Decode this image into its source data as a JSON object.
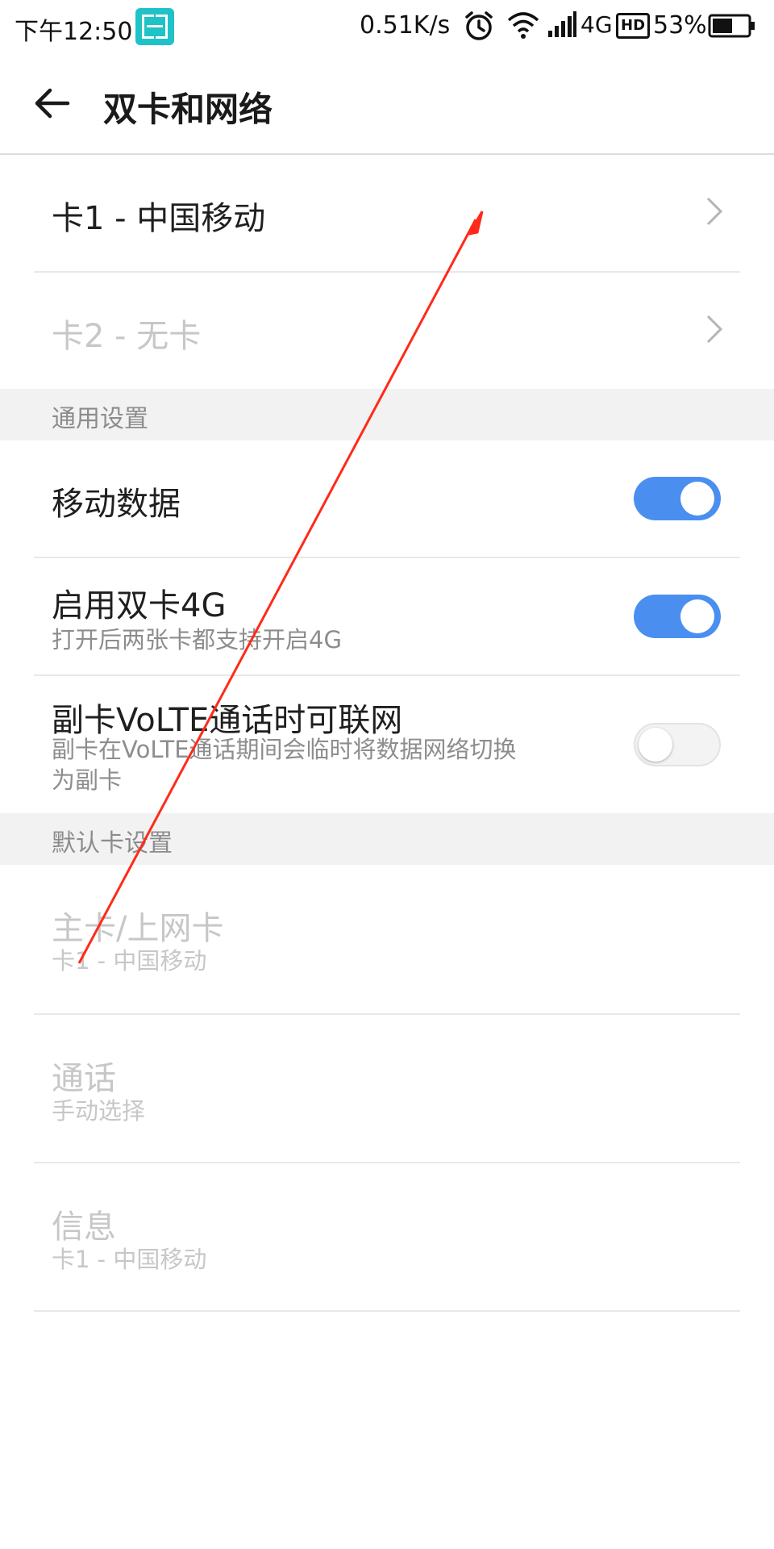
{
  "status_bar": {
    "time": "下午12:50",
    "net_speed": "0.51K/s",
    "network": "4G",
    "hd": "HD",
    "battery": "53%",
    "icons": [
      "screenshot-scan-icon",
      "alarm-icon",
      "wifi-icon",
      "signal-icon",
      "hd-icon",
      "battery-icon"
    ]
  },
  "header": {
    "title": "双卡和网络",
    "back_icon": "back-arrow-icon"
  },
  "sim_cards": [
    {
      "label": "卡1 - 中国移动",
      "enabled": true
    },
    {
      "label": "卡2 - 无卡",
      "enabled": false
    }
  ],
  "general": {
    "section_label": "通用设置",
    "mobile_data": {
      "label": "移动数据",
      "on": true
    },
    "dual_4g": {
      "label": "启用双卡4G",
      "sub": "打开后两张卡都支持开启4G",
      "on": true
    },
    "volte": {
      "label": "副卡VoLTE通话时可联网",
      "sub_line1": "副卡在VoLTE通话期间会临时将数据网络切换",
      "sub_line2": "为副卡",
      "on": false
    }
  },
  "default_card": {
    "section_label": "默认卡设置",
    "items": [
      {
        "label": "主卡/上网卡",
        "sub": "卡1 - 中国移动"
      },
      {
        "label": "通话",
        "sub": "手动选择"
      },
      {
        "label": "信息",
        "sub": "卡1 - 中国移动"
      }
    ]
  },
  "colors": {
    "accent": "#4a8ff0",
    "section_bg": "#f2f2f2",
    "disabled_text": "#c7c7c7",
    "annotation": "#ff2a1a"
  }
}
